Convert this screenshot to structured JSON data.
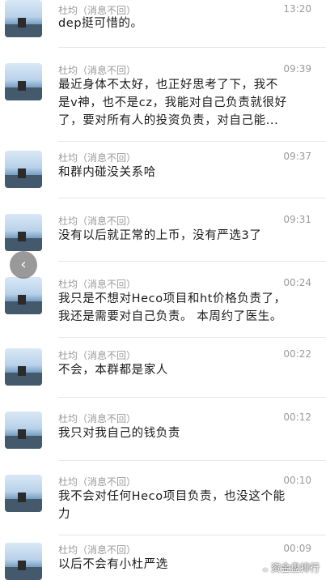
{
  "messages": [
    {
      "sender": "杜均（消息不回）",
      "time": "13:20",
      "lines": [
        "dep挺可惜的。"
      ]
    },
    {
      "sender": "杜均（消息不回）",
      "time": "09:39",
      "lines": [
        "最近身体不太好，也正好思考了下，我不",
        "是v神，也不是cz，我能对自己负责就很好",
        "了，要对所有人的投资负责，对自己能..."
      ]
    },
    {
      "sender": "杜均（消息不回）",
      "time": "09:37",
      "lines": [
        "和群内碰没关系哈"
      ]
    },
    {
      "sender": "杜均（消息不回）",
      "time": "09:31",
      "lines": [
        "没有以后就正常的上币，没有严选3了"
      ]
    },
    {
      "sender": "杜均（消息不回）",
      "time": "00:24",
      "lines": [
        "我只是不想对Heco项目和ht价格负责了，",
        "我还是需要对自己负责。 本周约了医生。"
      ]
    },
    {
      "sender": "杜均（消息不回）",
      "time": "00:22",
      "lines": [
        "不会，本群都是家人"
      ]
    },
    {
      "sender": "杜均（消息不回）",
      "time": "00:12",
      "lines": [
        "我只对我自己的钱负责"
      ]
    },
    {
      "sender": "杜均（消息不回）",
      "time": "00:10",
      "lines": [
        "我不会对任何Heco项目负责，也没这个能",
        "力"
      ]
    },
    {
      "sender": "杜均（消息不回）",
      "time": "00:09",
      "lines": [
        "以后不会有小杜严选"
      ]
    }
  ],
  "back_button_icon": "chevron-left-icon",
  "watermark": "资金盘排行"
}
